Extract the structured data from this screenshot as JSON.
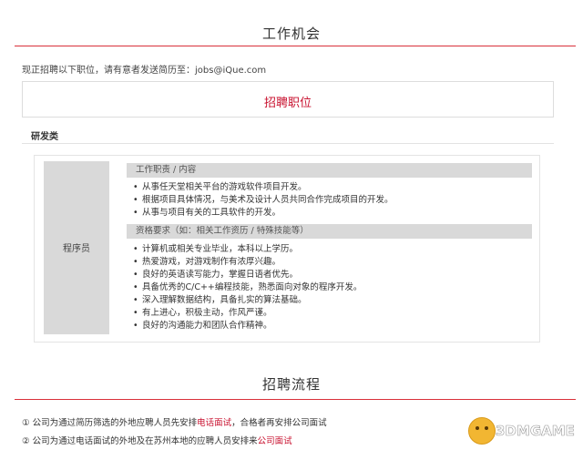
{
  "section1": {
    "title": "工作机会"
  },
  "intro": "现正招聘以下职位，请有意者发送简历至：jobs@iQue.com",
  "positions_label": "招聘职位",
  "category": "研发类",
  "role": "程序员",
  "duties": {
    "header": "工作职责 / 内容",
    "items": [
      "从事任天堂相关平台的游戏软件项目开发。",
      "根据项目具体情况，与美术及设计人员共同合作完成项目的开发。",
      "从事与项目有关的工具软件的开发。"
    ]
  },
  "requirements": {
    "header": "资格要求（如：相关工作资历 / 特殊技能等）",
    "items": [
      "计算机或相关专业毕业，本科以上学历。",
      "热爱游戏，对游戏制作有浓厚兴趣。",
      "良好的英语读写能力，掌握日语者优先。",
      "具备优秀的C/C++编程技能，熟悉面向对象的程序开发。",
      "深入理解数据结构，具备扎实的算法基础。",
      "有上进心，积极主动，作风严谨。",
      "良好的沟通能力和团队合作精神。"
    ]
  },
  "section2": {
    "title": "招聘流程"
  },
  "process": [
    {
      "num": "①",
      "pre": "公司为通过简历筛选的外地应聘人员先安排",
      "hl": "电话面试",
      "post": "，合格者再安排公司面试"
    },
    {
      "num": "②",
      "pre": "公司为通过电话面试的外地及在苏州本地的应聘人员安排来",
      "hl": "公司面试",
      "post": ""
    }
  ],
  "watermark": {
    "text": "3DMGAME"
  },
  "colors": {
    "accent": "#c8102e",
    "rule": "#d9313a",
    "header_bg": "#d9d9d9"
  }
}
